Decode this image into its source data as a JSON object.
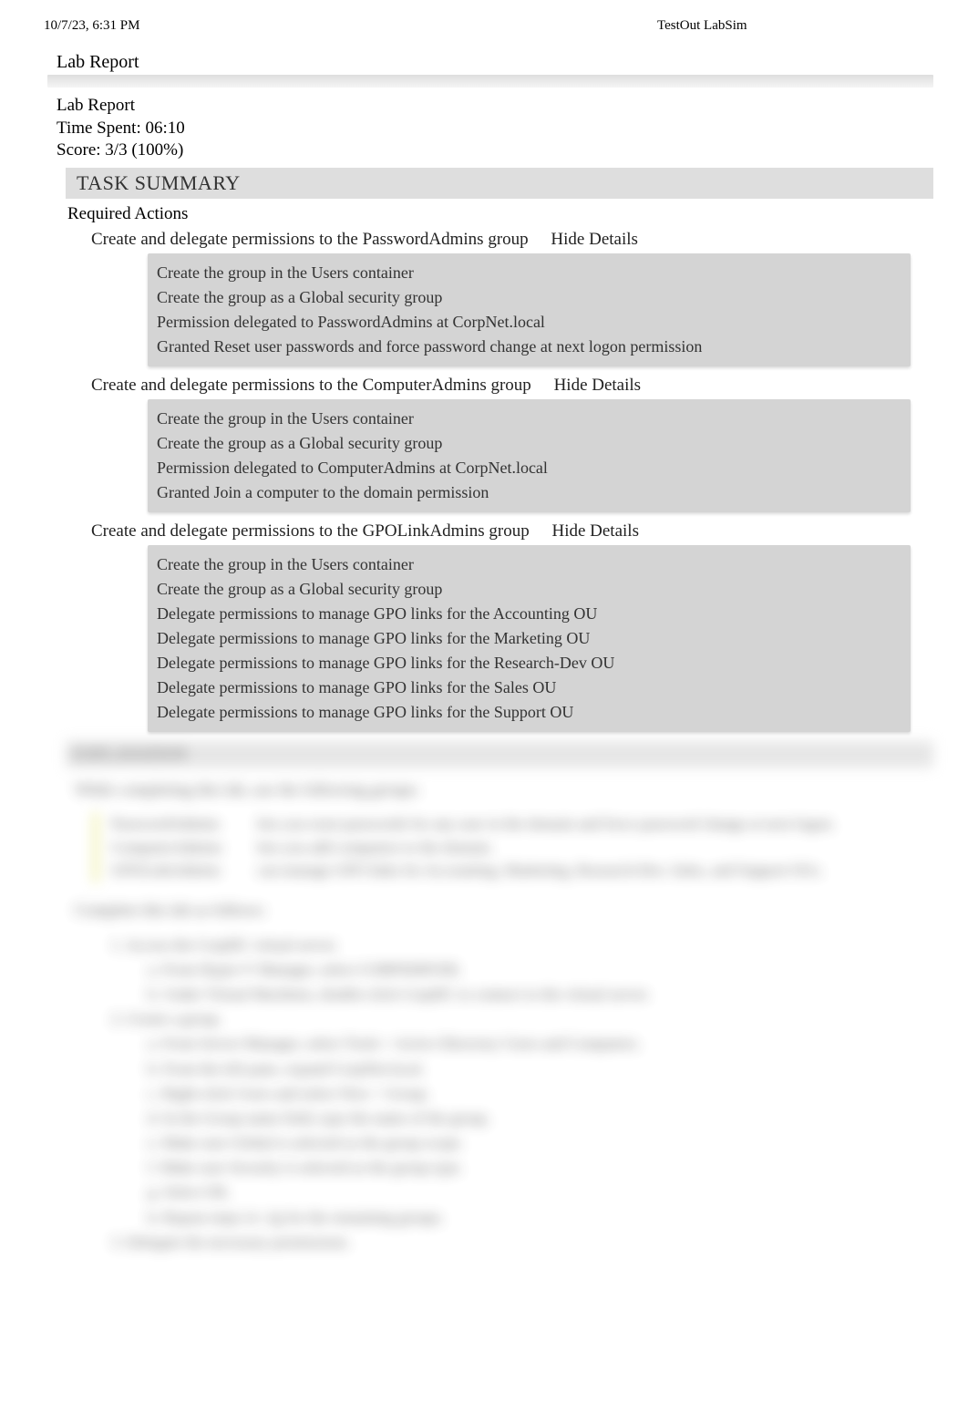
{
  "header": {
    "timestamp": "10/7/23, 6:31 PM",
    "app_title": "TestOut LabSim"
  },
  "report": {
    "title_outer": "Lab Report",
    "title_inner": "Lab Report",
    "time_spent_label": "Time Spent: ",
    "time_spent_value": "06:10",
    "score_label": "Score: ",
    "score_value": "3/3 (100%)",
    "task_summary_label": "TASK SUMMARY",
    "required_actions_label": "Required Actions",
    "hide_details_label": "Hide Details"
  },
  "tasks": [
    {
      "title": "Create and delegate permissions to the PasswordAdmins group",
      "details": [
        "Create the group in the Users container",
        "Create the group as a Global security group",
        "Permission delegated to PasswordAdmins at CorpNet.local",
        "Granted Reset user passwords and force password change at next logon permission"
      ]
    },
    {
      "title": "Create and delegate permissions to the ComputerAdmins group",
      "details": [
        "Create the group in the Users container",
        "Create the group as a Global security group",
        "Permission delegated to ComputerAdmins at CorpNet.local",
        "Granted Join a computer to the domain permission"
      ]
    },
    {
      "title": "Create and delegate permissions to the GPOLinkAdmins group",
      "details": [
        "Create the group in the Users container",
        "Create the group as a Global security group",
        "Delegate permissions to manage GPO links for the Accounting OU",
        "Delegate permissions to manage GPO links for the Marketing OU",
        "Delegate permissions to manage GPO links for the Research-Dev OU",
        "Delegate permissions to manage GPO links for the Sales OU",
        "Delegate permissions to manage GPO links for the Support OU"
      ]
    }
  ],
  "blurred": {
    "heading": "EXPLANATION",
    "intro": "While completing this lab, use the following groups:",
    "rows": [
      {
        "c1": "PasswordAdmins",
        "c2": "lets you reset passwords for any user in the domain and force password change at next logon."
      },
      {
        "c1": "ComputerAdmins",
        "c2": "lets you add computers to the domain."
      },
      {
        "c1": "GPOLinkAdmins",
        "c2": "can manage GPO links for Accounting, Marketing, Research-Dev, Sales, and Support OUs."
      }
    ],
    "complete": "Complete this lab as follows:",
    "steps": [
      {
        "t": "num",
        "text": "1. Access the CorpDC virtual server."
      },
      {
        "t": "sub",
        "text": "a. From Hyper-V Manager, select CORPSERVER."
      },
      {
        "t": "sub",
        "text": "b. Under Virtual Machines, double-click CorpDC to connect to the virtual server."
      },
      {
        "t": "num",
        "text": "2. Create a group."
      },
      {
        "t": "sub",
        "text": "a. From Server Manager, select Tools > Active Directory Users and Computers."
      },
      {
        "t": "sub",
        "text": "b. From the left pane, expand CorpNet.local."
      },
      {
        "t": "sub",
        "text": "c. Right-click Users and select New > Group."
      },
      {
        "t": "sub",
        "text": "d. In the Group name field, type the name of the group."
      },
      {
        "t": "sub",
        "text": "e. Make sure Global is selected as the group scope."
      },
      {
        "t": "sub",
        "text": "f. Make sure Security is selected as the group type."
      },
      {
        "t": "sub",
        "text": "g. Select OK."
      },
      {
        "t": "sub",
        "text": "h. Repeat steps 2c–2g for the remaining groups."
      },
      {
        "t": "num",
        "text": "3. Delegate the necessary permissions."
      }
    ]
  }
}
